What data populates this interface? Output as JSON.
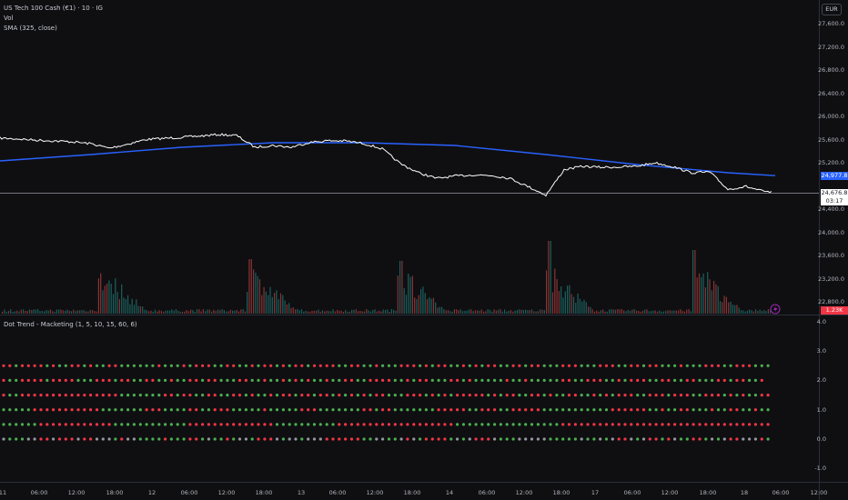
{
  "main_pane": {
    "symbol_title": "US Tech 100 Cash (€1) · 10 · IG",
    "volume_label": "Vol",
    "sma_label": "SMA (325, close)",
    "currency_button": "EUR",
    "price_axis": [
      "27,600.0",
      "27,200.0",
      "26,800.0",
      "26,400.0",
      "26,000.0",
      "25,600.0",
      "25,200.0",
      "24,400.0",
      "24,000.0",
      "23,600.0",
      "23,200.0",
      "22,800.0"
    ],
    "sma_badge": "24,977.8",
    "last_price_badge": "24,676.8",
    "countdown": "03:17",
    "volume_badge": "1.23K",
    "colors": {
      "price_line": "#ffffff",
      "sma": "#2962ff",
      "sma_badge": "#2962ff",
      "volume_badge": "#f23645",
      "volume_up": "#26a69a",
      "volume_down": "#ef5350",
      "alert_icon": "#9c27b0"
    },
    "price_series_approx": [
      25624,
      25610,
      25590,
      25576,
      25560,
      25529,
      25451,
      25520,
      25600,
      25620,
      25639,
      25660,
      25686,
      25670,
      25467,
      25498,
      25467,
      25550,
      25580,
      25576,
      25530,
      25440,
      25184,
      25027,
      24930,
      24970,
      24990,
      24980,
      24933,
      24792,
      24640,
      25080,
      25137,
      25122,
      25125,
      25140,
      25200,
      25130,
      25027,
      25040,
      24740,
      24790,
      24700,
      24677
    ],
    "sma_series_approx": [
      25231,
      25341,
      25467,
      25545,
      25545,
      25498,
      25341,
      25169,
      25027,
      24978
    ]
  },
  "indicator_pane": {
    "title": "Dot Trend - Macketing (1, 5, 10, 15, 60, 6)",
    "axis": [
      "4.0",
      "3.0",
      "2.0",
      "1.0",
      "0.0",
      "-1.0"
    ],
    "row_levels": [
      2.5,
      2.0,
      1.5,
      1.0,
      0.5,
      0.0
    ],
    "colors": {
      "g": "#4caf50",
      "r": "#f23645",
      "w": "#9598a1"
    },
    "rows": [
      "rrgrrrrgrggrrgrggrrggggggrgggrgrrrggrrggrgrrgrgrrgrrrrggrrggrgggrrrgrgrrggrgrgrrggrrgrrgggrrrgggrrrggrrgrrgggrgggrrrggrrrggg",
      "rggrrrrgrrrrgggrrrgrrggrrggrggrrgrrgggrrggrggrgrgrggrggrrggrrrrggrgrrgggrrgrgggggrggrgggggrrggrrrggrgrrrggrrggrrgggrrgrrggr",
      "rggrrrrrrrrrrrrrrrrgggggggrrgrrggrrggrrgrggrgrrgrrgrrgrgrgrgrrgggrrrgrgrgrrrrrgrgrrggrrgrggrrggrgrgrrrggrrrgrrrggrrrgrgrggrr",
      "gggggrrrrrrrrrrrgggggggrrrggggrrggrrrgggggrgggggrrrgggggggrrgrrgggggggrrrrrggrrrggrrrrrgggggggggggrrrrrrggrggrrgggrggrrggrgg",
      "ggggggrrrrrrrrrrrrggggggggggggrrrrrrrrrrrrrrggggggggggrrrrrrrrrrrrrrrrrrrgggggggggggggggggrrrrrrrrrrrrrrrrrrrrrrrrrrrrrrrrrrrrrr",
      "wgggwwrrwrrrwrrwwwgrwwggggrgggrrgwggrgwwgrrrwgwwgwwwrrrrrrggwwggwrwgrrrrgwgwrrrwgggwwwwwgggggwggwgwrrwgwrrgrwggrrgwgwrrwwwrgr"
    ]
  },
  "time_axis": [
    "11",
    "06:00",
    "12:00",
    "18:00",
    "12",
    "06:00",
    "12:00",
    "18:00",
    "13",
    "06:00",
    "12:00",
    "18:00",
    "14",
    "06:00",
    "12:00",
    "18:00",
    "17",
    "06:00",
    "12:00",
    "18:00",
    "18",
    "06:00",
    "12:00"
  ]
}
